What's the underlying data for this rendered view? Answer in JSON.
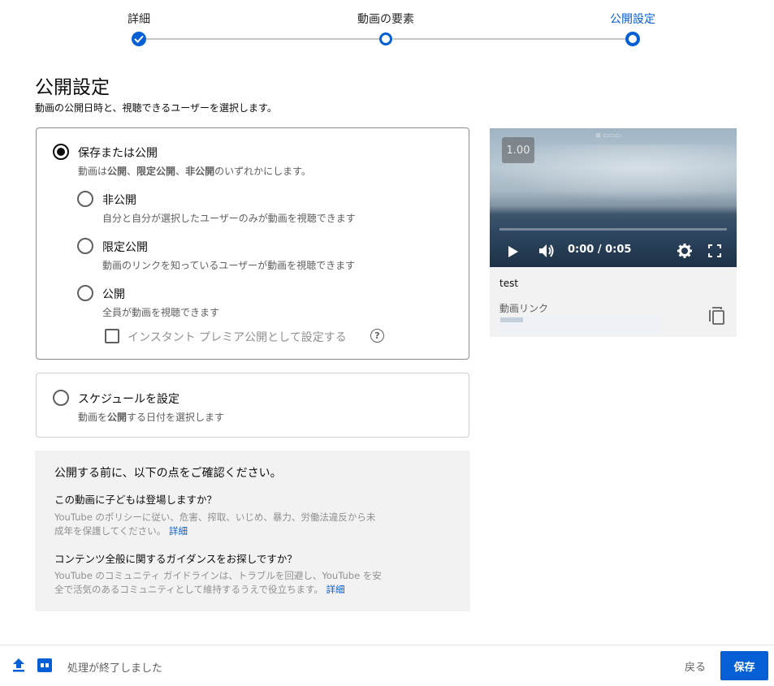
{
  "stepper": {
    "steps": [
      {
        "label": "詳細",
        "state": "done"
      },
      {
        "label": "動画の要素",
        "state": "visited"
      },
      {
        "label": "公開設定",
        "state": "current"
      }
    ]
  },
  "page": {
    "title": "公開設定",
    "subtitle": "動画の公開日時と、視聴できるユーザーを選択します。"
  },
  "save_or_publish": {
    "title": "保存または公開",
    "desc_prefix": "動画は",
    "desc_public": "公開",
    "desc_sep1": "、",
    "desc_unlisted": "限定公開",
    "desc_sep2": "、",
    "desc_private": "非公開",
    "desc_suffix": "のいずれかにします。",
    "selected": true,
    "options": [
      {
        "title": "非公開",
        "desc": "自分と自分が選択したユーザーのみが動画を視聴できます",
        "selected": false
      },
      {
        "title": "限定公開",
        "desc": "動画のリンクを知っているユーザーが動画を視聴できます",
        "selected": false
      },
      {
        "title": "公開",
        "desc": "全員が動画を視聴できます",
        "selected": false
      }
    ],
    "premiere_label": "インスタント プレミア公開として設定する",
    "premiere_checked": false
  },
  "schedule": {
    "title": "スケジュールを設定",
    "desc_prefix": "動画を",
    "desc_bold": "公開",
    "desc_suffix": "する日付を選択します",
    "selected": false
  },
  "info": {
    "heading": "公開する前に、以下の点をご確認ください。",
    "q1": "この動画に子どもは登場しますか？",
    "p1_line1": "YouTube のポリシーに従い、危害、搾取、いじめ、暴力、労働法違反から未",
    "p1_line2": "成年を保護してください。",
    "p1_link": "詳細",
    "q2": "コンテンツ全般に関するガイダンスをお探しですか？",
    "p2_line1": "YouTube のコミュニティ ガイドラインは、トラブルを回避し、YouTube を安",
    "p2_line2": "全で活気のあるコミュニティとして維持するうえで役立ちます。",
    "p2_link": "詳細"
  },
  "video": {
    "speed": "1.00",
    "time": "0:00 / 0:05",
    "progress": 0,
    "title": "test",
    "link_label": "動画リンク"
  },
  "footer": {
    "status": "処理が終了しました",
    "back_label": "戻る",
    "save_label": "保存"
  },
  "colors": {
    "accent": "#065fd4",
    "info_bg": "#f2f2f2"
  }
}
